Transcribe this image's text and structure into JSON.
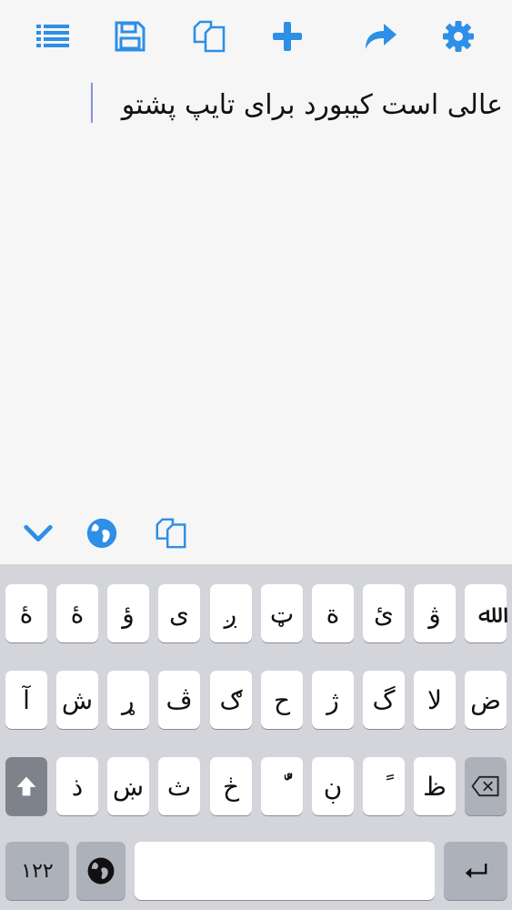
{
  "toolbar": {
    "icons": [
      "list-icon",
      "save-icon",
      "copy-icon",
      "plus-icon",
      "share-icon",
      "gear-icon"
    ],
    "accent": "#2d8fe6"
  },
  "editor": {
    "text": "عالی است کیبورد برای تایپ پشتو"
  },
  "accessory": {
    "icons": [
      "chevron-down-icon",
      "globe-icon",
      "copy-icon"
    ]
  },
  "keyboard": {
    "row1": [
      "ﷲ",
      "ۋ",
      "ئ",
      "ة",
      "ټ",
      "ږ",
      "ی",
      "ؤ",
      "ۀ"
    ],
    "row2": [
      "ض",
      "لا",
      "گ",
      "ژ",
      "ح",
      "ګ",
      "ڤ",
      "ړ",
      "ش",
      "آ"
    ],
    "row3": [
      "ظ",
      "ً",
      "ڼ",
      "ٌ",
      "ښ",
      "ث",
      "ڼ",
      "ذ"
    ],
    "row3_display": [
      "ظ",
      "ً",
      "ڹ",
      "ٌّ",
      "ڂ",
      "ث",
      "ښ",
      "ذ"
    ],
    "numbers_label": "۱۲۲",
    "space_label": "",
    "colors": {
      "bg": "#d3d5db",
      "key": "#ffffff",
      "function_key": "#acb1ba"
    }
  }
}
